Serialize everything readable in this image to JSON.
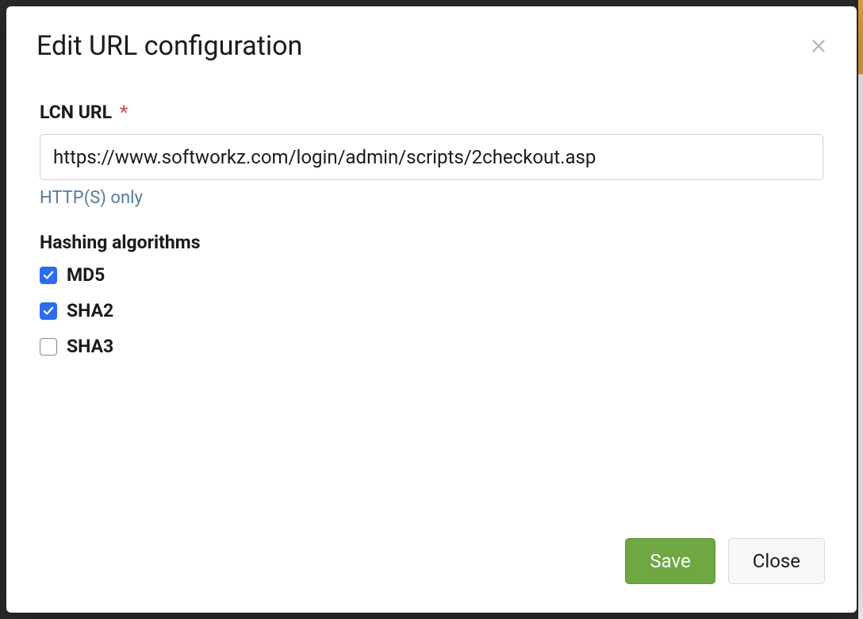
{
  "modal": {
    "title": "Edit URL configuration",
    "close_label": "Close dialog"
  },
  "form": {
    "url_field": {
      "label": "LCN URL",
      "required_mark": "*",
      "value": "https://www.softworkz.com/login/admin/scripts/2checkout.asp",
      "help": "HTTP(S) only"
    },
    "hashing": {
      "label": "Hashing algorithms",
      "options": [
        {
          "key": "md5",
          "label": "MD5",
          "checked": true
        },
        {
          "key": "sha2",
          "label": "SHA2",
          "checked": true
        },
        {
          "key": "sha3",
          "label": "SHA3",
          "checked": false
        }
      ]
    }
  },
  "actions": {
    "save_label": "Save",
    "close_label": "Close"
  }
}
